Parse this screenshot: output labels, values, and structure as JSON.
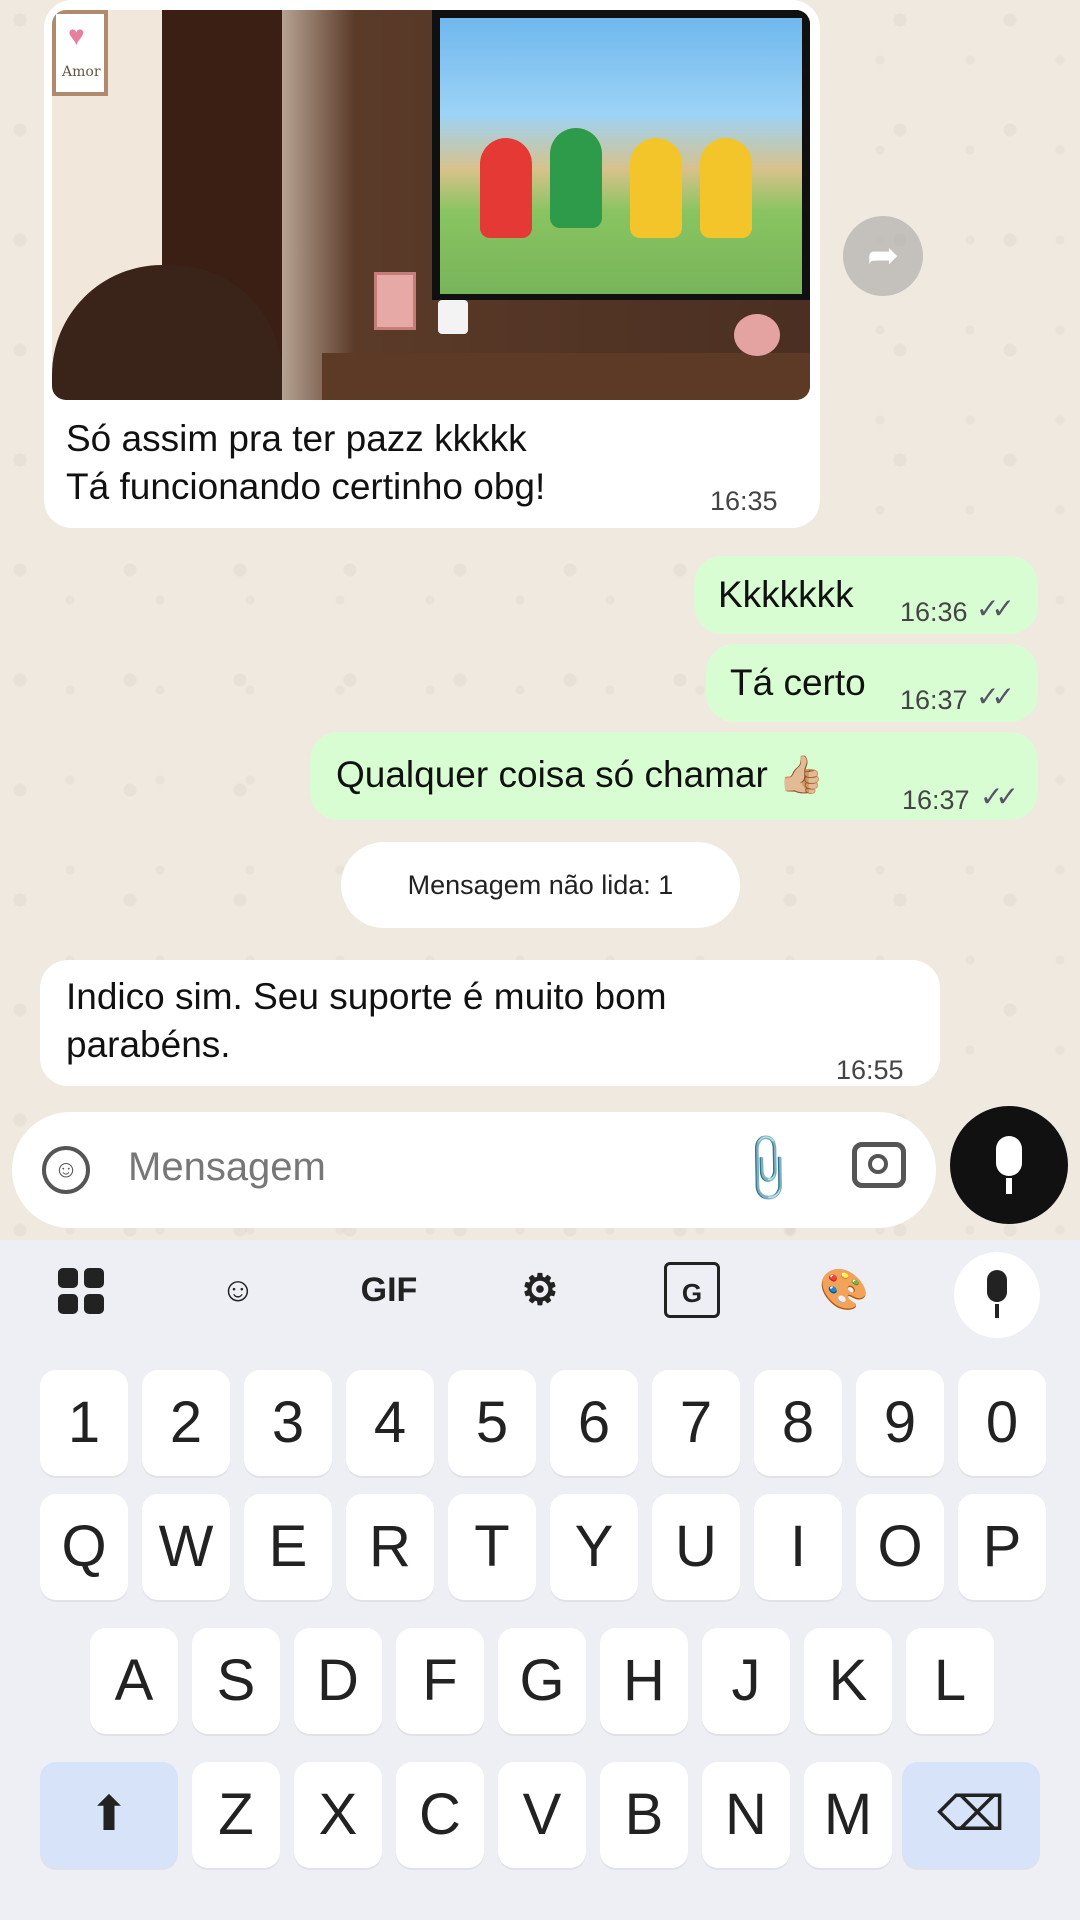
{
  "messages": {
    "incoming_1": {
      "caption_line1": "Só assim pra ter pazz kkkkk",
      "caption_line2": "Tá funcionando certinho obg!",
      "time": "16:35",
      "photo_frame_text": "Amor"
    },
    "outgoing": [
      {
        "text": "Kkkkkkk",
        "time": "16:36",
        "status": "read"
      },
      {
        "text": "Tá certo",
        "time": "16:37",
        "status": "read"
      },
      {
        "text": "Qualquer coisa só chamar 👍🏼",
        "time": "16:37",
        "status": "read"
      }
    ],
    "unread_divider": "Mensagem não lida: 1",
    "incoming_2": {
      "line1": "Indico sim. Seu suporte é muito bom",
      "line2": "parabéns.",
      "time": "16:55"
    }
  },
  "composer": {
    "placeholder": "Mensagem"
  },
  "keyboard": {
    "toolbar": [
      "apps-grid-icon",
      "sticker-icon",
      "GIF",
      "settings-gear-icon",
      "translate-icon",
      "palette-icon",
      "mic-icon"
    ],
    "gif_label": "GIF",
    "row_numbers": [
      "1",
      "2",
      "3",
      "4",
      "5",
      "6",
      "7",
      "8",
      "9",
      "0"
    ],
    "row_q": [
      "Q",
      "W",
      "E",
      "R",
      "T",
      "Y",
      "U",
      "I",
      "O",
      "P"
    ],
    "row_a": [
      "A",
      "S",
      "D",
      "F",
      "G",
      "H",
      "J",
      "K",
      "L"
    ],
    "row_z": [
      "Z",
      "X",
      "C",
      "V",
      "B",
      "N",
      "M"
    ]
  },
  "colors": {
    "outgoing_bubble": "#d9fdd3",
    "incoming_bubble": "#ffffff",
    "chat_background": "#efe9e0",
    "keyboard_background": "#edeff5",
    "special_key": "#d7e3f8"
  }
}
